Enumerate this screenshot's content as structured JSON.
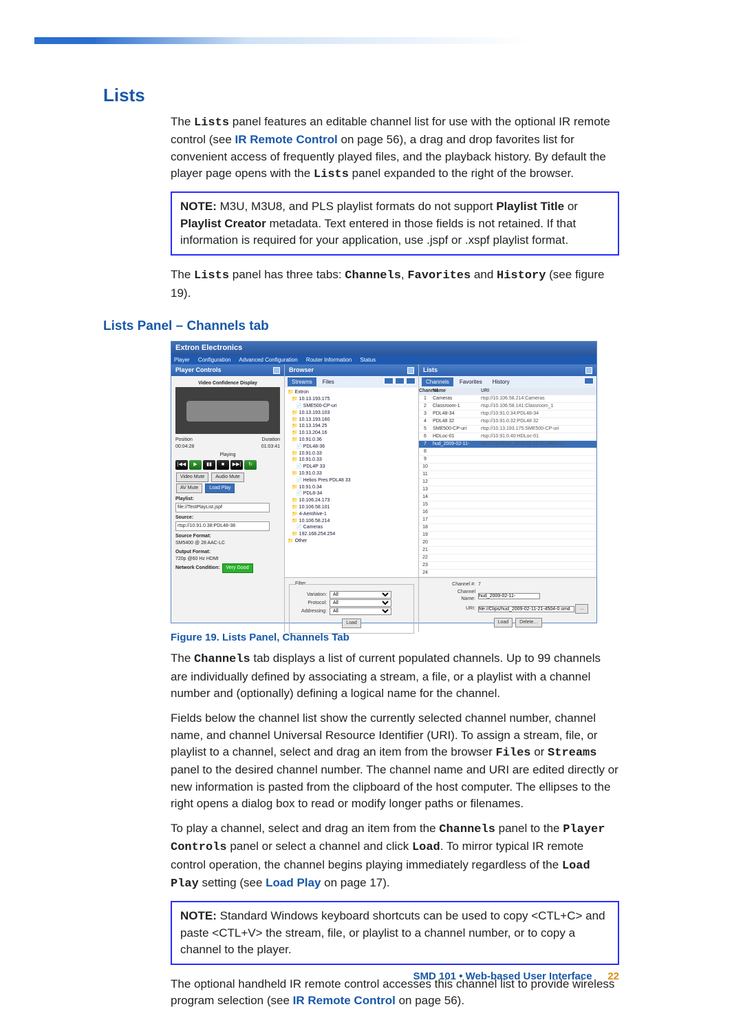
{
  "headings": {
    "main": "Lists",
    "sub": "Lists Panel – Channels tab"
  },
  "body": {
    "p1_a": "The ",
    "p1_b": "Lists",
    "p1_c": " panel features an editable channel list for use with the optional IR remote control (see ",
    "p1_d": "IR Remote Control",
    "p1_e": " on page 56), a drag and drop favorites list for convenient access of frequently played files, and the playback history. By default the player page opens with the ",
    "p1_f": "Lists",
    "p1_g": " panel expanded to the right of the browser.",
    "note1_a": "NOTE:",
    "note1_b": "   M3U, M3U8, and PLS playlist formats do not support ",
    "note1_c": "Playlist Title",
    "note1_d": " or ",
    "note1_e": "Playlist Creator",
    "note1_f": " metadata. Text entered in those fields is not retained. If that information is required for your application, use .jspf or .xspf playlist format.",
    "p2_a": "The ",
    "p2_b": "Lists",
    "p2_c": " panel has three tabs: ",
    "p2_d": "Channels",
    "p2_e": ", ",
    "p2_f": "Favorites",
    "p2_g": " and ",
    "p2_h": "History",
    "p2_i": " (see figure 19).",
    "p3_a": "The ",
    "p3_b": "Channels",
    "p3_c": " tab displays a list of current populated channels. Up to 99 channels are individually defined by associating a stream, a file, or a playlist with a channel number and (optionally) defining a logical name for the channel.",
    "p4_a": "Fields below the channel list show the currently selected channel number, channel name, and channel Universal Resource Identifier (URI). To assign a stream, file, or playlist to a channel, select and drag an item from the browser ",
    "p4_b": "Files",
    "p4_c": " or ",
    "p4_d": "Streams",
    "p4_e": " panel to the desired channel number. The channel name and URI are edited directly or new information is pasted from the clipboard of the host computer. The ellipses to the right opens a dialog box to read or modify longer paths or filenames.",
    "p5_a": "To play a channel, select and drag an item from the ",
    "p5_b": "Channels",
    "p5_c": " panel to the ",
    "p5_d": "Player Controls",
    "p5_e": " panel or select a channel and click ",
    "p5_f": "Load",
    "p5_g": ". To mirror typical IR remote control operation, the channel begins playing immediately regardless of the ",
    "p5_h": "Load Play",
    "p5_i": " setting (see ",
    "p5_j": "Load Play",
    "p5_k": " on page 17).",
    "note2_a": "NOTE:",
    "note2_b": "   Standard Windows keyboard shortcuts can be used to copy <CTL+C> and paste <CTL+V> the stream, file, or playlist to a channel number, or to copy a channel to the player.",
    "p6_a": "The optional handheld IR remote control accesses this channel list to provide wireless program selection (see ",
    "p6_b": "IR Remote Control",
    "p6_c": " on page 56)."
  },
  "figure": {
    "app_title": "Extron Electronics",
    "menu": [
      "Player",
      "Configuration",
      "Advanced Configuration",
      "Router Information",
      "Status"
    ],
    "panels": {
      "controls": "Player Controls",
      "browser": "Browser",
      "lists": "Lists"
    },
    "controls_sub": "Video Confidence Display",
    "position_label": "Position",
    "position_val": "00:04:28",
    "duration_label": "Duration",
    "duration_val": "01:03:41",
    "playing": "Playing",
    "buttons": {
      "video_mute": "Video Mute",
      "audio_mute": "Audio Mute",
      "av_mute": "AV Mute",
      "load_play": "Load Play"
    },
    "playlist_label": "Playlist:",
    "playlist_val": "file://TestPlayList.jspf",
    "source_label": "Source:",
    "source_val": "rtsp://10.91.0.38:PDL48-38",
    "source_fmt_label": "Source Format:",
    "source_fmt_val": "SM5400 @ 28 AAC-LC",
    "output_fmt_label": "Output Format:",
    "output_fmt_val": "720p @60 Hz HDMI",
    "network_label": "Network Condition:",
    "network_val": "Very Good",
    "browser_tabs": {
      "streams": "Streams",
      "files": "Files"
    },
    "lists_tabs": {
      "channels": "Channels",
      "favorites": "Favorites",
      "history": "History"
    },
    "tree": [
      "Extron",
      " 10.13.193.175",
      "  SME500-CP-uri",
      " 10.13.193.103",
      " 10.13.193.160",
      " 10.13.194.25",
      " 10.13.204.16",
      " 10.91.0.36",
      "  PDL48-36",
      " 10.91.0.33",
      " 10.91.0.33",
      "  PDL4P 33",
      " 10.91.0.33",
      "  Helios Pres PDL48 33",
      " 10.91.0.34",
      "  PDL8-34",
      " 10.106.24.173",
      " 10.106.58.101",
      " 4-Aerohive-1",
      " 10.106.58.214",
      "  Cameras",
      " 192.168.254.254",
      "Other"
    ],
    "chan_header": [
      "Channel",
      "Name",
      "URI"
    ],
    "channels": [
      {
        "n": "1",
        "name": "Cameras",
        "uri": "rtsp://10.106.58.214:Cameras"
      },
      {
        "n": "2",
        "name": "Classroom-1",
        "uri": "rtsp://10.106.58.141:Classroom_1"
      },
      {
        "n": "3",
        "name": "PDL48-34",
        "uri": "rtsp://10.91.0.34:PDL48-34"
      },
      {
        "n": "4",
        "name": "PDL48 32",
        "uri": "rtsp://10.91.0.32:PDL48 32"
      },
      {
        "n": "5",
        "name": "SME500-CP-uri",
        "uri": "rtsp://10.13.193.175:SME500-CP-uri"
      },
      {
        "n": "6",
        "name": "HDLoc-01",
        "uri": "rtsp://10.91.0.40:HDLoc-01"
      },
      {
        "n": "7",
        "name": "hud_2009-02-11-",
        "uri": "file://Clips/hud_2009-02-11-21-4504-0.r"
      },
      {
        "n": "8",
        "name": "",
        "uri": ""
      },
      {
        "n": "9",
        "name": "",
        "uri": ""
      },
      {
        "n": "10",
        "name": "",
        "uri": ""
      },
      {
        "n": "11",
        "name": "",
        "uri": ""
      },
      {
        "n": "12",
        "name": "",
        "uri": ""
      },
      {
        "n": "13",
        "name": "",
        "uri": ""
      },
      {
        "n": "14",
        "name": "",
        "uri": ""
      },
      {
        "n": "15",
        "name": "",
        "uri": ""
      },
      {
        "n": "16",
        "name": "",
        "uri": ""
      },
      {
        "n": "17",
        "name": "",
        "uri": ""
      },
      {
        "n": "18",
        "name": "",
        "uri": ""
      },
      {
        "n": "19",
        "name": "",
        "uri": ""
      },
      {
        "n": "20",
        "name": "",
        "uri": ""
      },
      {
        "n": "21",
        "name": "",
        "uri": ""
      },
      {
        "n": "22",
        "name": "",
        "uri": ""
      },
      {
        "n": "23",
        "name": "",
        "uri": ""
      },
      {
        "n": "24",
        "name": "",
        "uri": ""
      }
    ],
    "filter": {
      "label": "Filter",
      "variation": "Variation:",
      "protocol": "Protocol:",
      "addressing": "Addressing:",
      "all": "All",
      "load": "Load"
    },
    "chan_edit": {
      "chno_label": "Channel #:",
      "chno_val": "7",
      "name_label": "Channel Name:",
      "name_val": "hud_2009-02-11-",
      "uri_label": "URI:",
      "uri_val": "file://Clips/hud_2009-02-11-21-4504-0.smd",
      "load": "Load",
      "delete": "Delete…"
    }
  },
  "caption": "Figure 19.  Lists Panel, Channels Tab",
  "footer": {
    "text": "SMD 101 • Web-based User Interface",
    "page": "22"
  }
}
